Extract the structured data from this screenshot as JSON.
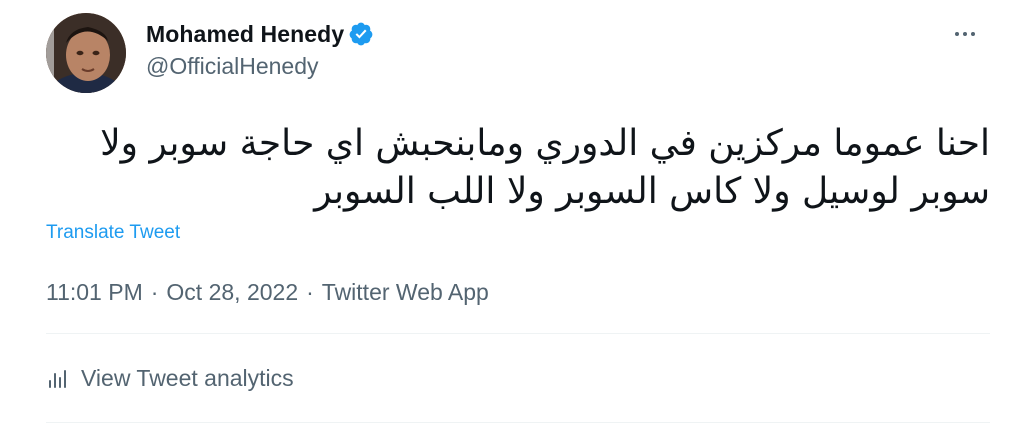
{
  "author": {
    "display_name": "Mohamed Henedy",
    "handle": "@OfficialHenedy",
    "verified": true,
    "avatar_icon": "profile-photo"
  },
  "tweet": {
    "text": "احنا عموما مركزين في الدوري ومابنحبش اي حاجة سوبر ولا سوبر لوسيل ولا كاس السوبر ولا اللب السوبر",
    "translate_label": "Translate Tweet"
  },
  "meta": {
    "time": "11:01 PM",
    "separator": "·",
    "date": "Oct 28, 2022",
    "source": "Twitter Web App"
  },
  "analytics": {
    "label": "View Tweet analytics",
    "icon": "bar-chart-icon"
  },
  "more_menu": {
    "icon": "more-horizontal-icon"
  },
  "colors": {
    "text": "#0f1419",
    "secondary": "#536471",
    "link": "#1d9bf0",
    "verified": "#1d9bf0",
    "divider": "#eff3f4"
  }
}
